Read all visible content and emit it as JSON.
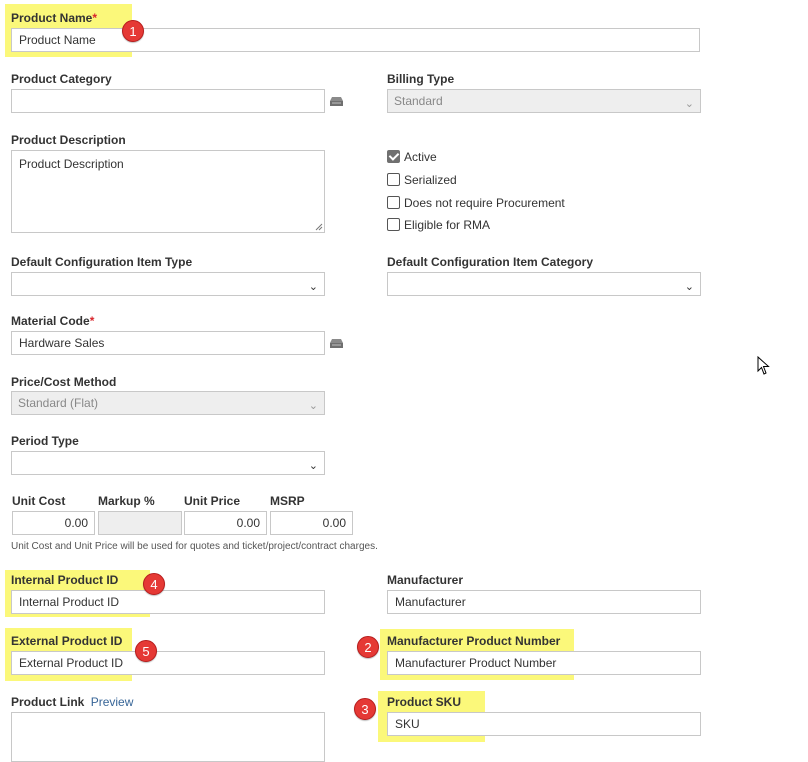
{
  "product_name": {
    "label": "Product Name",
    "required_mark": "*",
    "value": "Product Name"
  },
  "product_category": {
    "label": "Product Category",
    "value": "",
    "lookup_icon": "lookup-icon"
  },
  "billing_type": {
    "label": "Billing Type",
    "value": "Standard"
  },
  "product_description": {
    "label": "Product Description",
    "value": "Product Description"
  },
  "checkboxes": [
    {
      "label": "Active",
      "checked": true
    },
    {
      "label": "Serialized",
      "checked": false
    },
    {
      "label": "Does not require Procurement",
      "checked": false
    },
    {
      "label": "Eligible for RMA",
      "checked": false
    }
  ],
  "default_ci_type": {
    "label": "Default Configuration Item Type",
    "value": ""
  },
  "default_ci_category": {
    "label": "Default Configuration Item Category",
    "value": ""
  },
  "material_code": {
    "label": "Material Code",
    "required_mark": "*",
    "value": "Hardware Sales"
  },
  "price_cost_method": {
    "label": "Price/Cost Method",
    "value": "Standard (Flat)"
  },
  "period_type": {
    "label": "Period Type",
    "value": ""
  },
  "pricing": {
    "unit_cost": {
      "label": "Unit Cost",
      "value": "0.00"
    },
    "markup": {
      "label": "Markup %",
      "value": ""
    },
    "unit_price": {
      "label": "Unit Price",
      "value": "0.00"
    },
    "msrp": {
      "label": "MSRP",
      "value": "0.00"
    },
    "note": "Unit Cost and Unit Price will be used for quotes and ticket/project/contract charges."
  },
  "internal_product_id": {
    "label": "Internal Product ID",
    "value": "Internal Product ID"
  },
  "manufacturer": {
    "label": "Manufacturer",
    "value": "Manufacturer"
  },
  "external_product_id": {
    "label": "External Product ID",
    "value": "External Product ID"
  },
  "manufacturer_product_number": {
    "label": "Manufacturer Product Number",
    "value": "Manufacturer Product Number"
  },
  "product_link": {
    "label": "Product Link",
    "preview_link": "Preview",
    "value": ""
  },
  "product_sku": {
    "label": "Product SKU",
    "value": "SKU"
  },
  "badges": [
    "1",
    "2",
    "3",
    "4",
    "5"
  ],
  "colors": {
    "highlight": "#fbf87a",
    "badge": "#e53935",
    "required": "#d9262c",
    "link": "#376597"
  }
}
